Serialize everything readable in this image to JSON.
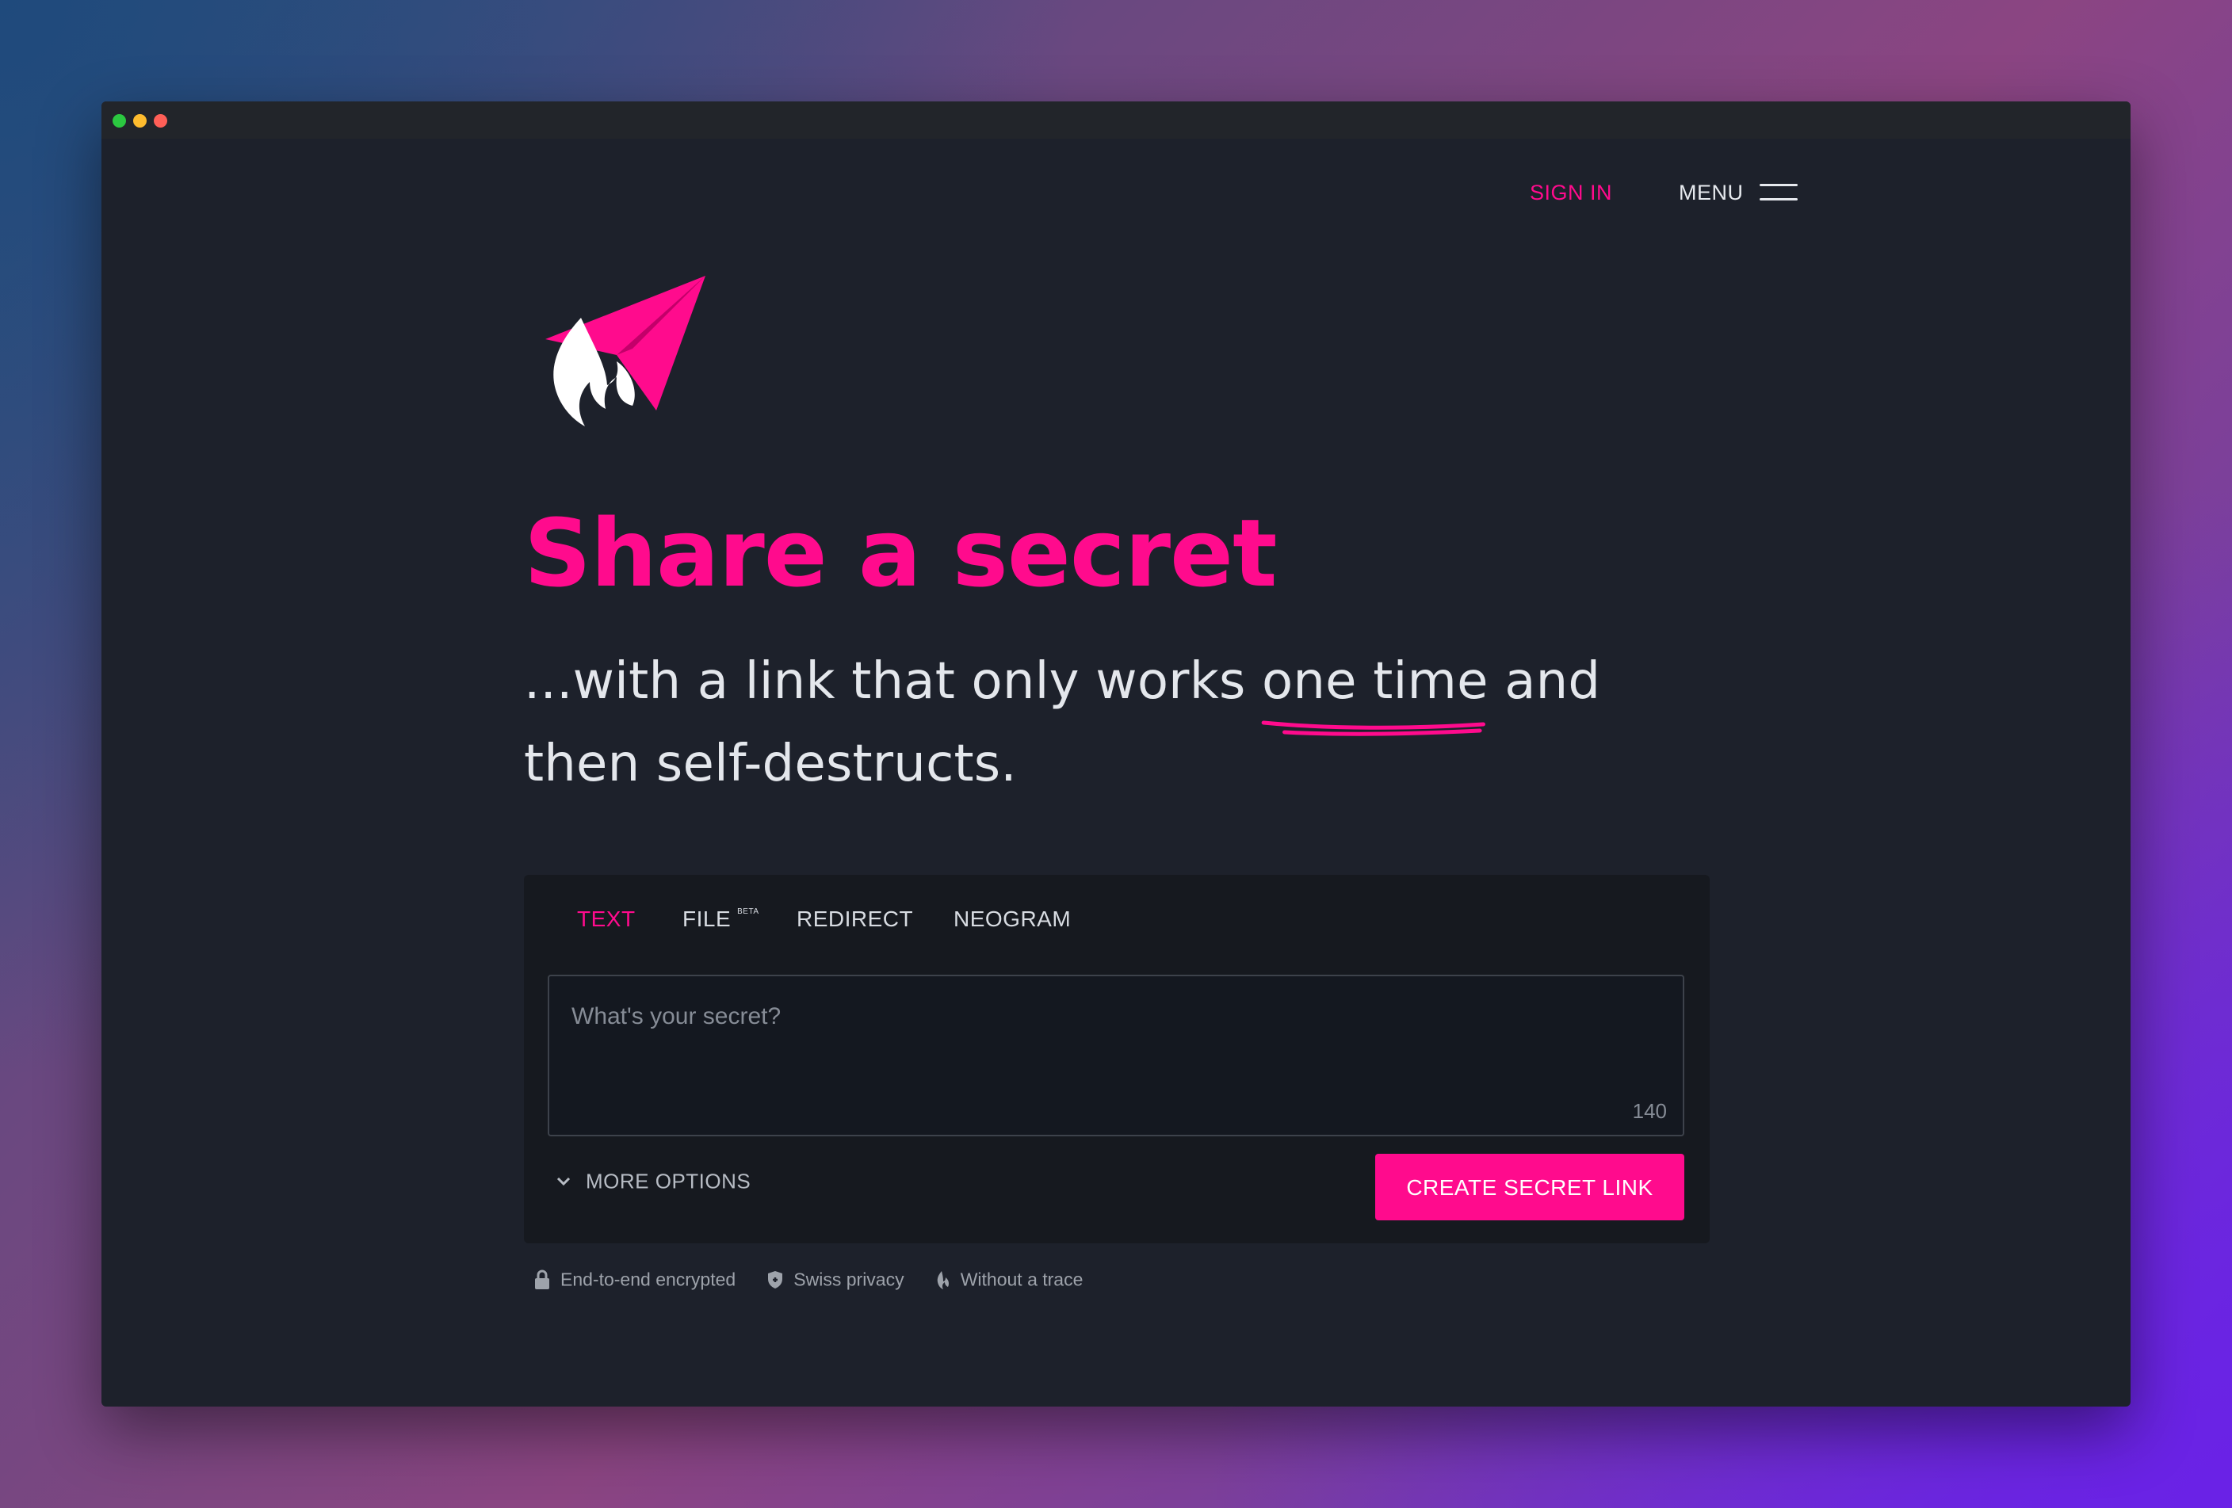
{
  "nav": {
    "sign_in": "SIGN IN",
    "menu": "MENU"
  },
  "hero": {
    "title": "Share a secret",
    "subtitle_before": "...with a link that only works ",
    "subtitle_highlight": "one time",
    "subtitle_after": " and then self-destructs."
  },
  "tabs": [
    {
      "label": "TEXT",
      "active": true
    },
    {
      "label": "FILE",
      "badge": "BETA"
    },
    {
      "label": "REDIRECT"
    },
    {
      "label": "NEOGRAM"
    }
  ],
  "secret_input": {
    "placeholder": "What's your secret?",
    "value": "",
    "remaining_chars": "140"
  },
  "more_options": "MORE OPTIONS",
  "create_button": "CREATE SECRET LINK",
  "features": [
    {
      "icon": "lock-icon",
      "label": "End-to-end encrypted"
    },
    {
      "icon": "shield-icon",
      "label": "Swiss privacy"
    },
    {
      "icon": "flame-icon",
      "label": "Without a trace"
    }
  ],
  "colors": {
    "accent": "#ff0b8d",
    "background": "#1d212b",
    "card": "#16191f"
  }
}
